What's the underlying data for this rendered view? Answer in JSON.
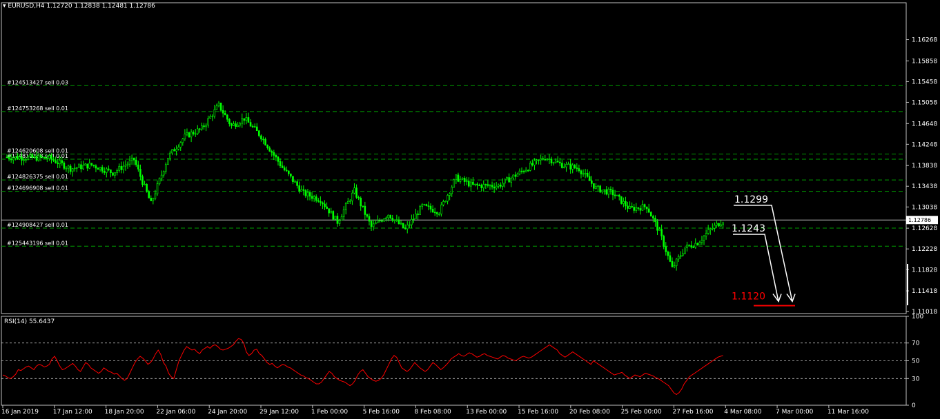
{
  "header": {
    "symbol": "EURUSD,H4",
    "ohlc": "1.12720 1.12838 1.12481 1.12786"
  },
  "rsi_header": "RSI(14) 55.6437",
  "colors": {
    "background": "#000000",
    "candle_up": "#00ff00",
    "order_line": "#00a000",
    "rsi_line": "#ff0000",
    "annotation": "#ffffff",
    "target": "#ff0000",
    "price_line": "#c0c0c0"
  },
  "current_price_label": "1.12786",
  "annotations": {
    "level_a": "1.1299",
    "level_b": "1.1243",
    "target": "1.1120"
  },
  "chart_data": [
    {
      "type": "candlestick",
      "title": "EURUSD,H4",
      "ylim": [
        1.1098,
        1.1698
      ],
      "y_ticks": [
        "1.16268",
        "1.15858",
        "1.15458",
        "1.15058",
        "1.14648",
        "1.14248",
        "1.13838",
        "1.13438",
        "1.13038",
        "1.12628",
        "1.12228",
        "1.11828",
        "1.11418",
        "1.11018"
      ],
      "x_ticks": [
        "16 Jan 2019",
        "17 Jan 12:00",
        "18 Jan 20:00",
        "22 Jan 06:00",
        "24 Jan 20:00",
        "29 Jan 12:00",
        "1 Feb 00:00",
        "5 Feb 16:00",
        "8 Feb 08:00",
        "13 Feb 00:00",
        "15 Feb 16:00",
        "20 Feb 08:00",
        "25 Feb 00:00",
        "27 Feb 16:00",
        "4 Mar 08:00",
        "7 Mar 00:00",
        "11 Mar 16:00"
      ],
      "path": [
        {
          "bar": 0,
          "close": 1.14
        },
        {
          "bar": 20,
          "close": 1.1398
        },
        {
          "bar": 30,
          "close": 1.1378
        },
        {
          "bar": 40,
          "close": 1.1385
        },
        {
          "bar": 50,
          "close": 1.137
        },
        {
          "bar": 60,
          "close": 1.1395
        },
        {
          "bar": 68,
          "close": 1.131
        },
        {
          "bar": 76,
          "close": 1.14
        },
        {
          "bar": 84,
          "close": 1.144
        },
        {
          "bar": 92,
          "close": 1.1455
        },
        {
          "bar": 100,
          "close": 1.15
        },
        {
          "bar": 106,
          "close": 1.146
        },
        {
          "bar": 112,
          "close": 1.1475
        },
        {
          "bar": 120,
          "close": 1.144
        },
        {
          "bar": 130,
          "close": 1.138
        },
        {
          "bar": 140,
          "close": 1.133
        },
        {
          "bar": 148,
          "close": 1.1318
        },
        {
          "bar": 156,
          "close": 1.1275
        },
        {
          "bar": 164,
          "close": 1.1335
        },
        {
          "bar": 172,
          "close": 1.1265
        },
        {
          "bar": 180,
          "close": 1.129
        },
        {
          "bar": 188,
          "close": 1.126
        },
        {
          "bar": 196,
          "close": 1.1305
        },
        {
          "bar": 204,
          "close": 1.1295
        },
        {
          "bar": 212,
          "close": 1.136
        },
        {
          "bar": 220,
          "close": 1.1345
        },
        {
          "bar": 232,
          "close": 1.1345
        },
        {
          "bar": 244,
          "close": 1.1375
        },
        {
          "bar": 254,
          "close": 1.14
        },
        {
          "bar": 262,
          "close": 1.1385
        },
        {
          "bar": 270,
          "close": 1.1378
        },
        {
          "bar": 278,
          "close": 1.134
        },
        {
          "bar": 286,
          "close": 1.133
        },
        {
          "bar": 294,
          "close": 1.13
        },
        {
          "bar": 302,
          "close": 1.1305
        },
        {
          "bar": 308,
          "close": 1.1255
        },
        {
          "bar": 314,
          "close": 1.1185
        },
        {
          "bar": 320,
          "close": 1.1225
        },
        {
          "bar": 326,
          "close": 1.1235
        },
        {
          "bar": 332,
          "close": 1.126
        },
        {
          "bar": 338,
          "close": 1.1278
        }
      ],
      "orders": [
        {
          "label": "#124513427 sell 0.03",
          "price": 1.1538
        },
        {
          "label": "#124753268 sell 0.01",
          "price": 1.1488
        },
        {
          "label": "#124620608 sell 0.01",
          "price": 1.1406
        },
        {
          "label": "#124811238 sell 0.01",
          "price": 1.1396
        },
        {
          "label": "#124826375 sell 0.01",
          "price": 1.1356
        },
        {
          "label": "#124696908 sell 0.01",
          "price": 1.1334
        },
        {
          "label": "#124908427 sell 0.01",
          "price": 1.1263
        },
        {
          "label": "#125443196 sell 0.01",
          "price": 1.1228
        }
      ],
      "current_price": 1.12786
    },
    {
      "type": "line",
      "title": "RSI(14) 55.6437",
      "ylim": [
        0,
        100
      ],
      "y_ticks": [
        100,
        70,
        50,
        30,
        0
      ],
      "levels": [
        70,
        50,
        30
      ],
      "series": [
        {
          "values": [
            34,
            33,
            31,
            30,
            32,
            35,
            40,
            39,
            41,
            43,
            44,
            42,
            40,
            44,
            46,
            45,
            43,
            44,
            46,
            52,
            55,
            50,
            44,
            40,
            41,
            43,
            45,
            47,
            44,
            40,
            38,
            43,
            48,
            46,
            42,
            40,
            38,
            36,
            38,
            42,
            40,
            38,
            37,
            35,
            36,
            33,
            30,
            28,
            30,
            36,
            42,
            48,
            52,
            55,
            53,
            50,
            46,
            48,
            52,
            58,
            62,
            57,
            48,
            44,
            36,
            32,
            30,
            40,
            50,
            56,
            62,
            66,
            64,
            62,
            63,
            60,
            58,
            62,
            64,
            66,
            64,
            67,
            68,
            66,
            63,
            62,
            63,
            64,
            66,
            68,
            72,
            75,
            74,
            70,
            60,
            56,
            58,
            62,
            63,
            58,
            56,
            52,
            48,
            46,
            47,
            44,
            42,
            44,
            46,
            45,
            43,
            42,
            40,
            38,
            36,
            34,
            33,
            31,
            30,
            28,
            26,
            24,
            24,
            26,
            30,
            34,
            38,
            36,
            32,
            30,
            28,
            27,
            26,
            24,
            22,
            24,
            28,
            34,
            38,
            40,
            36,
            32,
            30,
            28,
            27,
            28,
            30,
            34,
            40,
            46,
            52,
            56,
            54,
            48,
            42,
            40,
            38,
            40,
            44,
            48,
            45,
            42,
            40,
            38,
            40,
            44,
            48,
            46,
            43,
            40,
            42,
            45,
            48,
            52,
            54,
            56,
            58,
            56,
            55,
            57,
            59,
            58,
            56,
            54,
            55,
            57,
            58,
            56,
            55,
            54,
            53,
            52,
            54,
            56,
            55,
            53,
            52,
            51,
            50,
            52,
            54,
            55,
            54,
            53,
            54,
            56,
            58,
            60,
            62,
            64,
            66,
            68,
            66,
            64,
            62,
            58,
            56,
            54,
            56,
            58,
            60,
            58,
            56,
            54,
            52,
            50,
            48,
            46,
            50,
            48,
            46,
            44,
            42,
            40,
            38,
            36,
            34,
            35,
            36,
            37,
            34,
            32,
            30,
            32,
            34,
            33,
            32,
            34,
            36,
            35,
            34,
            33,
            31,
            30,
            28,
            26,
            24,
            22,
            18,
            14,
            12,
            14,
            18,
            24,
            28,
            32,
            34,
            36,
            38,
            40,
            42,
            44,
            46,
            48,
            50,
            52,
            54,
            55,
            56
          ]
        }
      ]
    }
  ]
}
